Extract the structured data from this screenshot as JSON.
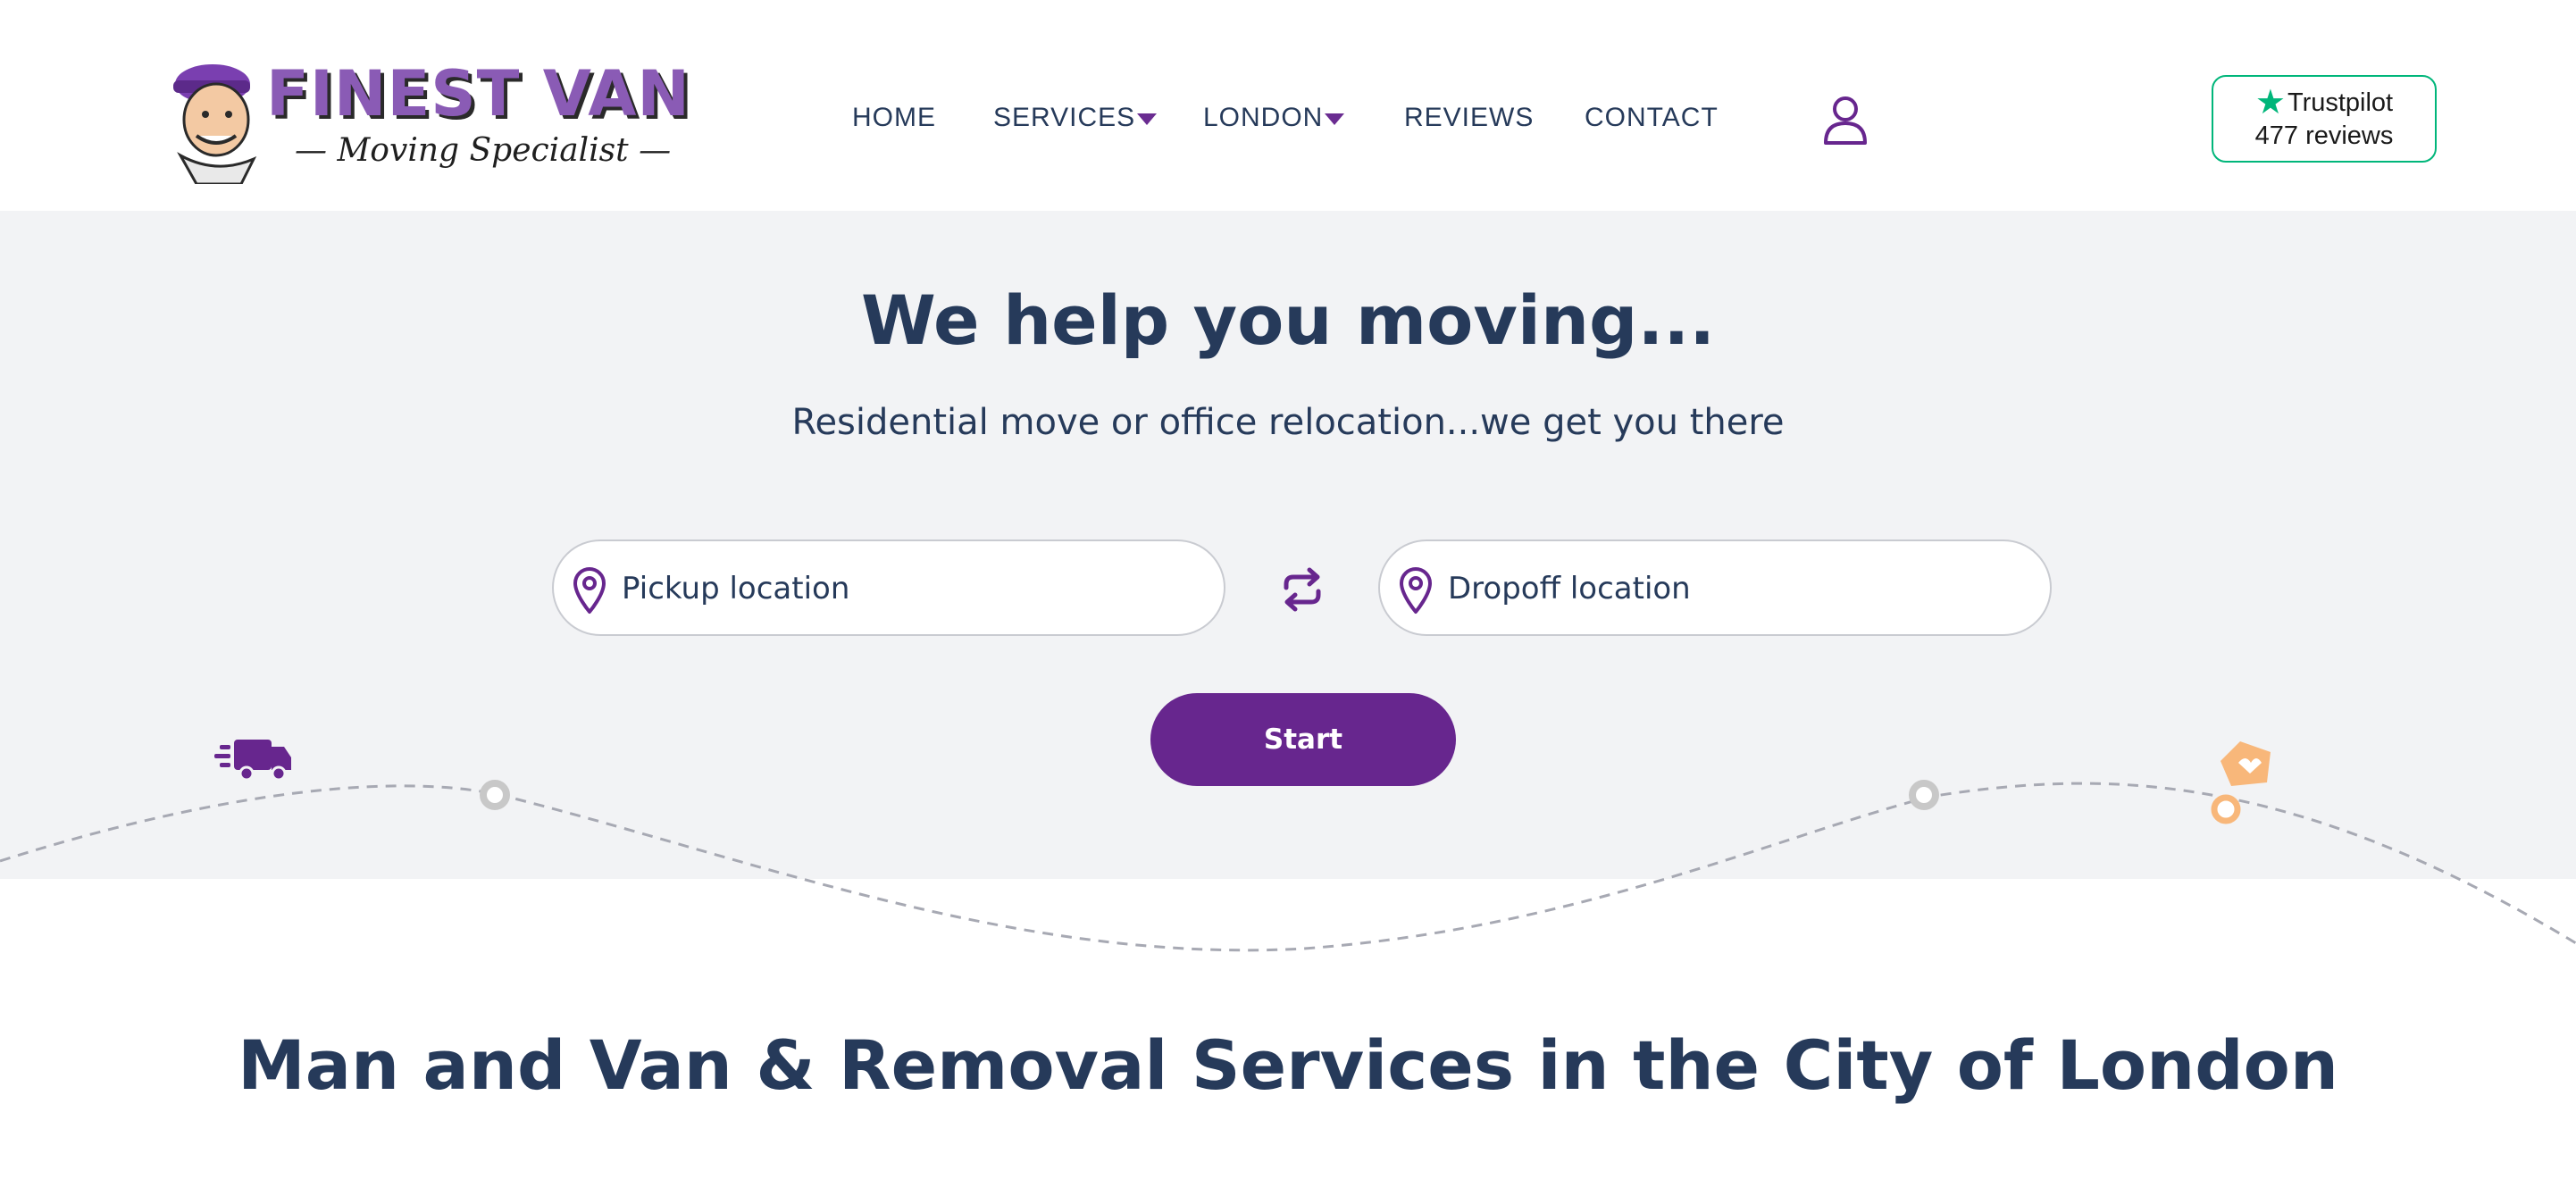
{
  "header": {
    "logo": {
      "title": "FINEST VAN",
      "subtitle": "— Moving Specialist —"
    },
    "nav": [
      {
        "label": "HOME",
        "dropdown": false
      },
      {
        "label": "SERVICES",
        "dropdown": true
      },
      {
        "label": "LONDON",
        "dropdown": true
      },
      {
        "label": "REVIEWS",
        "dropdown": false
      },
      {
        "label": "CONTACT",
        "dropdown": false
      }
    ],
    "user_icon": "user-icon",
    "trustpilot": {
      "brand": "Trustpilot",
      "reviews": "477 reviews"
    }
  },
  "hero": {
    "title": "We help you moving...",
    "subtitle": "Residential move or office relocation...we get you there",
    "pickup": {
      "placeholder": "Pickup location",
      "value": ""
    },
    "dropoff": {
      "placeholder": "Dropoff location",
      "value": ""
    },
    "start_label": "Start"
  },
  "section": {
    "title": "Man and Van & Removal Services in the City of London"
  },
  "colors": {
    "accent": "#67268e",
    "heading": "#263a5a",
    "hero_bg": "#f2f3f5",
    "trustpilot_green": "#00b67a",
    "house_orange": "#f8b77a"
  }
}
